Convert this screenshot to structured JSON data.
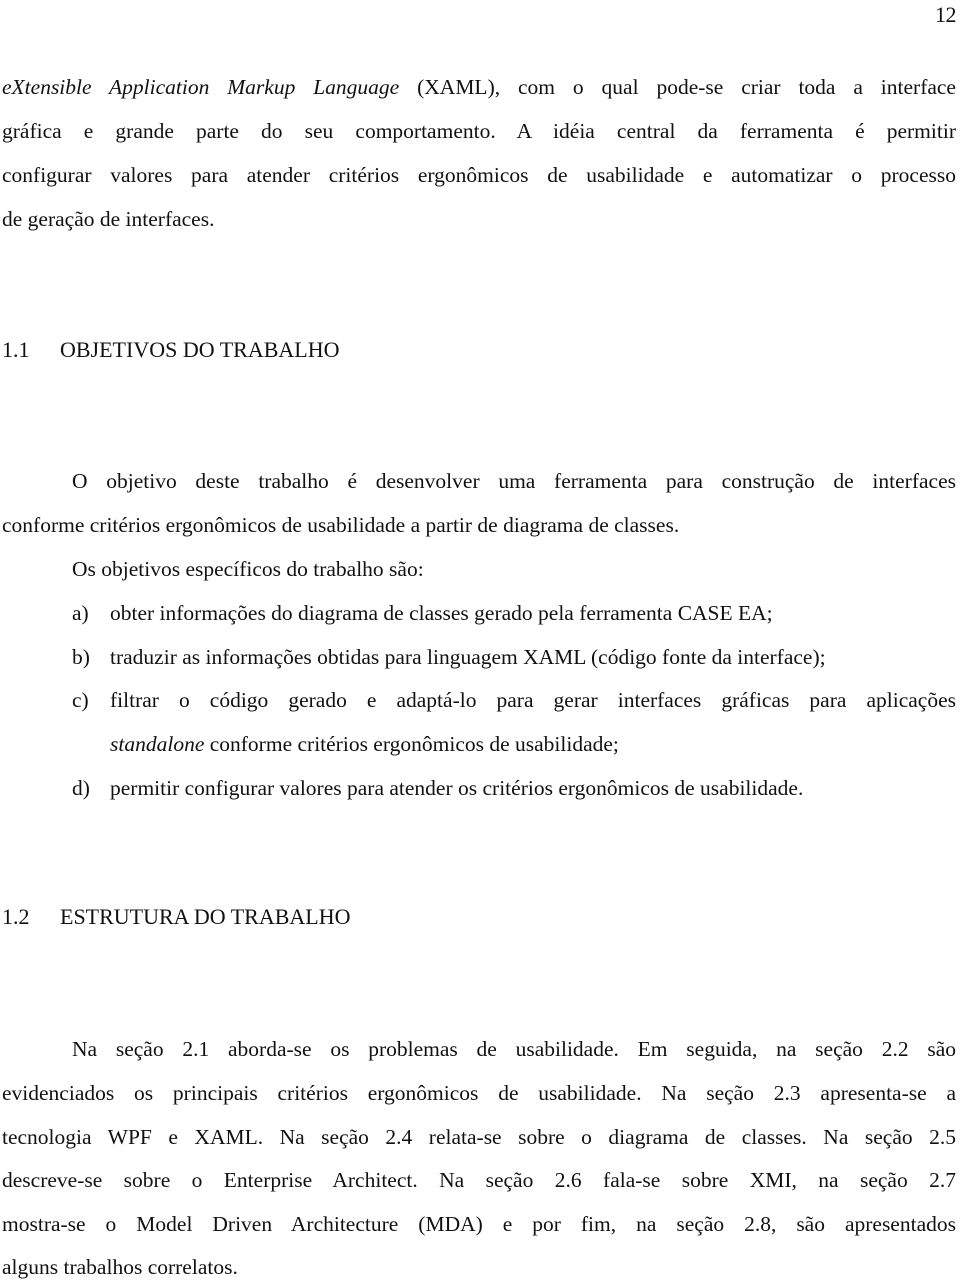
{
  "page_number": "12",
  "intro_paragraph": {
    "lines": [
      {
        "italic": "eXtensible Application Markup Language",
        "text": " (XAML), com o qual pode-se criar toda a interface"
      },
      {
        "text": "gráfica e grande parte do seu comportamento. A idéia central da ferramenta é permitir"
      },
      {
        "text": "configurar valores para atender critérios ergonômicos de usabilidade e automatizar o processo"
      },
      {
        "text": "de geração de interfaces."
      }
    ]
  },
  "section_1_1": {
    "number": "1.1",
    "title": "OBJETIVOS DO TRABALHO",
    "paragraph_lines": [
      "O objetivo deste trabalho é desenvolver uma ferramenta para construção de interfaces",
      "conforme critérios ergonômicos de usabilidade a partir de diagrama de classes."
    ],
    "specific_intro": "Os objetivos específicos do trabalho são:",
    "items": [
      {
        "label": "a)",
        "text": "obter informações do diagrama de classes gerado pela ferramenta CASE EA;"
      },
      {
        "label": "b)",
        "text": "traduzir as informações obtidas para linguagem XAML (código fonte da interface);"
      },
      {
        "label": "c)",
        "text": "filtrar o código gerado e adaptá-lo para gerar interfaces gráficas  para aplicações",
        "cont_italic": "standalone",
        "cont_text": " conforme critérios ergonômicos de usabilidade;"
      },
      {
        "label": "d)",
        "text": "permitir configurar valores para atender os critérios ergonômicos de usabilidade."
      }
    ]
  },
  "section_1_2": {
    "number": "1.2",
    "title": "ESTRUTURA DO TRABALHO",
    "paragraph_lines": [
      "Na seção 2.1 aborda-se os problemas de usabilidade. Em seguida, na seção 2.2 são",
      "evidenciados os principais critérios ergonômicos de usabilidade. Na seção 2.3 apresenta-se a",
      "tecnologia WPF e XAML. Na seção 2.4 relata-se sobre o diagrama de classes. Na seção 2.5",
      "descreve-se sobre o Enterprise Architect. Na seção 2.6 fala-se sobre XMI, na seção 2.7",
      "mostra-se o Model Driven Architecture (MDA) e por fim, na seção 2.8, são apresentados",
      "alguns trabalhos correlatos."
    ]
  }
}
